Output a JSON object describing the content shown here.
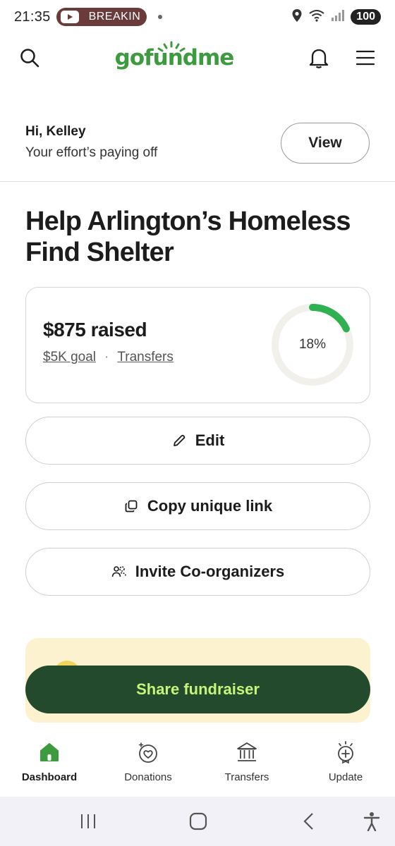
{
  "status_bar": {
    "time": "21:35",
    "notification_text": "BREAKIN",
    "battery": "100"
  },
  "header": {
    "logo": "gofundme"
  },
  "greeting": {
    "name": "Hi, Kelley",
    "message": "Your effort’s paying off",
    "view_label": "View"
  },
  "fundraiser": {
    "title": "Help Arlington’s Homeless Find Shelter",
    "raised": "$875 raised",
    "goal_link": "$5K goal",
    "separator": "·",
    "transfers_link": "Transfers",
    "progress_label": "18%",
    "progress_fraction": 0.18
  },
  "actions": {
    "edit_label": "Edit",
    "copy_label": "Copy unique link",
    "invite_label": "Invite Co-organizers",
    "share_label": "Share fundraiser"
  },
  "bottom_nav": {
    "items": [
      {
        "label": "Dashboard",
        "icon": "home-icon",
        "active": true
      },
      {
        "label": "Donations",
        "icon": "heart-donation-icon",
        "active": false
      },
      {
        "label": "Transfers",
        "icon": "bank-icon",
        "active": false
      },
      {
        "label": "Update",
        "icon": "update-plus-icon",
        "active": false
      }
    ]
  },
  "colors": {
    "brand_green": "#3c9b3f",
    "share_bg": "#234a2c",
    "share_text": "#c8f47b",
    "progress_track": "#f1f0ea",
    "promo_bg": "#fdf2cf"
  }
}
